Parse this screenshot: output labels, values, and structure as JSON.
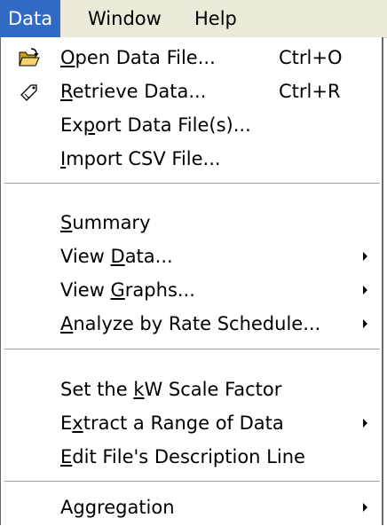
{
  "menubar": {
    "items": [
      {
        "label": "Data"
      },
      {
        "label": "Window"
      },
      {
        "label": "Help"
      }
    ]
  },
  "menu": {
    "items": [
      {
        "label": "Open Data File...",
        "shortcut": "Ctrl+O",
        "mnemonic": "O",
        "icon": "open-folder-icon"
      },
      {
        "label": "Retrieve Data...",
        "shortcut": "Ctrl+R",
        "mnemonic": "R",
        "icon": "retrieve-tag-icon"
      },
      {
        "label": "Export Data File(s)...",
        "mnemonic": "p"
      },
      {
        "label": "Import CSV File...",
        "mnemonic": "I"
      },
      {
        "label": "Summary",
        "mnemonic": "S"
      },
      {
        "label": "View Data...",
        "mnemonic": "D",
        "submenu": true
      },
      {
        "label": "View Graphs...",
        "mnemonic": "G",
        "submenu": true
      },
      {
        "label": "Analyze by Rate Schedule...",
        "mnemonic": "A",
        "submenu": true
      },
      {
        "label": "Set the kW Scale Factor",
        "mnemonic": "k"
      },
      {
        "label": "Extract a Range of Data",
        "mnemonic": "x",
        "submenu": true
      },
      {
        "label": "Edit File's Description Line",
        "mnemonic": "E"
      },
      {
        "label": "Aggregation",
        "submenu": true
      }
    ]
  },
  "colors": {
    "menubar_bg": "#ece9d8",
    "highlight": "#316ac5",
    "menu_bg": "#ffffff",
    "separator": "#a0a0a0"
  }
}
